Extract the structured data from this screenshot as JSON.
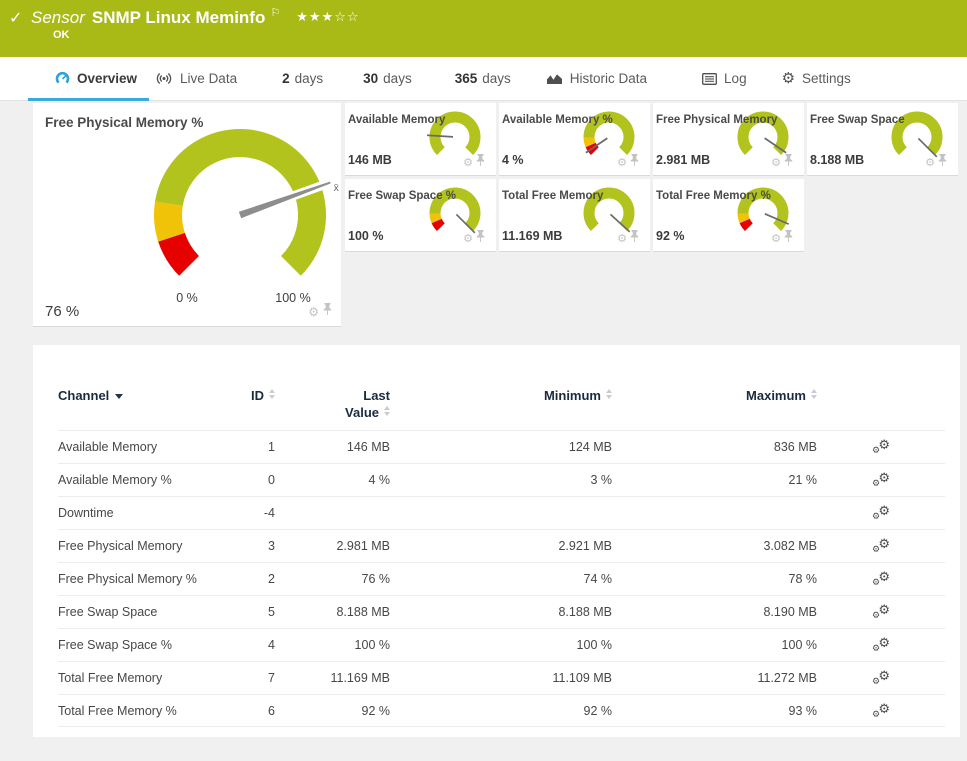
{
  "header": {
    "check_icon": "✓",
    "kind": "Sensor",
    "title": "SNMP Linux Meminfo",
    "flag_icon": "⚐",
    "stars_filled": "★★★",
    "stars_empty": "☆☆",
    "status": "OK"
  },
  "tabs": [
    {
      "id": "overview",
      "label": "Overview",
      "icon": "gauge-icon",
      "active": true
    },
    {
      "id": "live-data",
      "label": "Live Data",
      "icon": "live-icon",
      "active": false
    },
    {
      "id": "2-days",
      "number": "2",
      "label": "days",
      "active": false
    },
    {
      "id": "30-days",
      "number": "30",
      "label": "days",
      "active": false
    },
    {
      "id": "365-days",
      "number": "365",
      "label": "days",
      "active": false
    },
    {
      "id": "historic-data",
      "label": "Historic Data",
      "icon": "area-chart-icon",
      "active": false
    },
    {
      "id": "log",
      "label": "Log",
      "icon": "log-icon",
      "active": false
    },
    {
      "id": "settings",
      "label": "Settings",
      "icon": "gear-icon",
      "active": false
    }
  ],
  "colors": {
    "brand_green": "#a9ba17",
    "gauge_green": "#b2c31d",
    "gauge_yellow": "#f0c309",
    "gauge_red": "#e60000",
    "needle_gray": "#8d8d8d",
    "accent_blue": "#3aa9dd",
    "table_header_navy": "#1b2a3e"
  },
  "main_gauge": {
    "title": "Free Physical Memory %",
    "value": "76 %",
    "percent": 76,
    "scale_min": "0 %",
    "scale_max": "100 %",
    "mean_marker": "x̄",
    "segments": [
      {
        "from": 0,
        "to": 10,
        "color": "gauge_red"
      },
      {
        "from": 10,
        "to": 20,
        "color": "gauge_yellow"
      },
      {
        "from": 20,
        "to": 100,
        "color": "gauge_green"
      }
    ]
  },
  "limit_segments": [
    {
      "from": 0,
      "to": 8,
      "color": "gauge_red"
    },
    {
      "from": 8,
      "to": 16,
      "color": "gauge_yellow"
    },
    {
      "from": 16,
      "to": 100,
      "color": "gauge_green"
    }
  ],
  "plain_segments": [
    {
      "from": 0,
      "to": 100,
      "color": "gauge_green"
    }
  ],
  "mini_gauges": [
    {
      "id": "available-memory",
      "title": "Available Memory",
      "value": "146 MB",
      "percent": 18,
      "has_limits": false
    },
    {
      "id": "available-memory-pct",
      "title": "Available Memory %",
      "value": "4 %",
      "percent": 4,
      "has_limits": true
    },
    {
      "id": "free-physical-memory",
      "title": "Free Physical Memory",
      "value": "2.981 MB",
      "percent": 96,
      "has_limits": false
    },
    {
      "id": "free-swap-space",
      "title": "Free Swap Space",
      "value": "8.188 MB",
      "percent": 100,
      "has_limits": false
    },
    {
      "id": "free-swap-space-pct",
      "title": "Free Swap Space %",
      "value": "100 %",
      "percent": 100,
      "has_limits": true
    },
    {
      "id": "total-free-memory",
      "title": "Total Free Memory",
      "value": "11.169 MB",
      "percent": 99,
      "has_limits": false
    },
    {
      "id": "total-free-memory-pct",
      "title": "Total Free Memory %",
      "value": "92 %",
      "percent": 92,
      "has_limits": true
    }
  ],
  "channel_table": {
    "columns": [
      {
        "key": "channel",
        "label": "Channel",
        "sorted": true
      },
      {
        "key": "id",
        "label": "ID",
        "sorted": false
      },
      {
        "key": "last",
        "label": "Last Value",
        "sorted": false
      },
      {
        "key": "min",
        "label": "Minimum",
        "sorted": false
      },
      {
        "key": "max",
        "label": "Maximum",
        "sorted": false
      }
    ],
    "rows": [
      {
        "channel": "Available Memory",
        "id": "1",
        "last": "146 MB",
        "min": "124 MB",
        "max": "836 MB"
      },
      {
        "channel": "Available Memory %",
        "id": "0",
        "last": "4 %",
        "min": "3 %",
        "max": "21 %"
      },
      {
        "channel": "Downtime",
        "id": "-4",
        "last": "",
        "min": "",
        "max": ""
      },
      {
        "channel": "Free Physical Memory",
        "id": "3",
        "last": "2.981 MB",
        "min": "2.921 MB",
        "max": "3.082 MB"
      },
      {
        "channel": "Free Physical Memory %",
        "id": "2",
        "last": "76 %",
        "min": "74 %",
        "max": "78 %"
      },
      {
        "channel": "Free Swap Space",
        "id": "5",
        "last": "8.188 MB",
        "min": "8.188 MB",
        "max": "8.190 MB"
      },
      {
        "channel": "Free Swap Space %",
        "id": "4",
        "last": "100 %",
        "min": "100 %",
        "max": "100 %"
      },
      {
        "channel": "Total Free Memory",
        "id": "7",
        "last": "11.169 MB",
        "min": "11.109 MB",
        "max": "11.272 MB"
      },
      {
        "channel": "Total Free Memory %",
        "id": "6",
        "last": "92 %",
        "min": "92 %",
        "max": "93 %"
      }
    ]
  }
}
